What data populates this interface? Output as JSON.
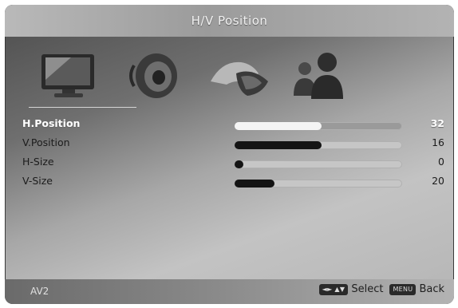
{
  "title": "H/V Position",
  "icons": [
    {
      "name": "picture-icon"
    },
    {
      "name": "sound-icon"
    },
    {
      "name": "setup-icon"
    },
    {
      "name": "parental-icon"
    }
  ],
  "menu": {
    "items": [
      {
        "label": "H.Position",
        "value": "32",
        "level_pct": 52,
        "selected": true
      },
      {
        "label": "V.Position",
        "value": "16",
        "level_pct": 52,
        "selected": false
      },
      {
        "label": "H-Size",
        "value": "0",
        "level_pct": 0,
        "selected": false
      },
      {
        "label": "V-Size",
        "value": "20",
        "level_pct": 24,
        "selected": false
      }
    ]
  },
  "footer": {
    "source": "AV2",
    "nav_key_label": "◄► ▲▼",
    "select_label": "Select",
    "menu_key_label": "MENU",
    "back_label": "Back"
  },
  "colors": {
    "bar_fill": "#141414",
    "bar_fill_selected": "#f4f4f4",
    "bar_track": "#c6c6c6",
    "title_text": "#f2f2f2"
  }
}
